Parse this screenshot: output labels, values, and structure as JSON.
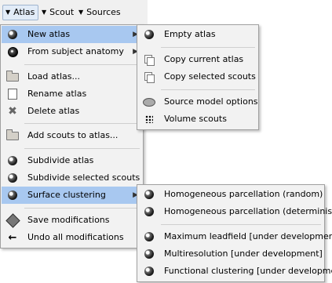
{
  "tabs": [
    {
      "label": "Atlas",
      "active": true
    },
    {
      "label": "Scout",
      "active": false
    },
    {
      "label": "Sources",
      "active": false
    }
  ],
  "atlas_menu": [
    {
      "label": "New atlas",
      "icon": "atlas-globe-icon",
      "submenu": true,
      "highlighted": true
    },
    {
      "label": "From subject anatomy",
      "icon": "brain-icon",
      "submenu": true
    },
    {
      "label": "Load atlas...",
      "icon": "folder-open-icon"
    },
    {
      "label": "Rename atlas",
      "icon": "edit-page-icon"
    },
    {
      "label": "Delete atlas",
      "icon": "delete-x-icon"
    },
    {
      "label": "Add scouts to atlas...",
      "icon": "folder-open-icon"
    },
    {
      "label": "Subdivide atlas",
      "icon": "atlas-globe-icon"
    },
    {
      "label": "Subdivide selected scouts",
      "icon": "atlas-globe-icon"
    },
    {
      "label": "Surface clustering",
      "icon": "atlas-globe-icon",
      "submenu": true,
      "highlighted": true
    },
    {
      "label": "Save modifications",
      "icon": "save-icon"
    },
    {
      "label": "Undo all modifications",
      "icon": "undo-arrow-icon"
    }
  ],
  "new_atlas_submenu": [
    {
      "label": "Empty atlas",
      "icon": "atlas-globe-icon"
    },
    {
      "label": "Copy current atlas",
      "icon": "copy-icon"
    },
    {
      "label": "Copy selected scouts",
      "icon": "copy-icon"
    },
    {
      "label": "Source model options",
      "icon": "cortex-surface-icon"
    },
    {
      "label": "Volume scouts",
      "icon": "volume-dots-icon"
    }
  ],
  "clustering_submenu": [
    {
      "label": "Homogeneous parcellation (random)",
      "icon": "atlas-globe-icon"
    },
    {
      "label": "Homogeneous parcellation (deterministic)",
      "icon": "atlas-globe-icon"
    },
    {
      "label": "Maximum leadfield [under development]",
      "icon": "atlas-globe-icon"
    },
    {
      "label": "Multiresolution [under development]",
      "icon": "atlas-globe-icon"
    },
    {
      "label": "Functional clustering [under development]",
      "icon": "atlas-globe-icon"
    }
  ],
  "colors": {
    "highlight": "#a8c8f0",
    "menu_bg": "#f2f2f2"
  }
}
